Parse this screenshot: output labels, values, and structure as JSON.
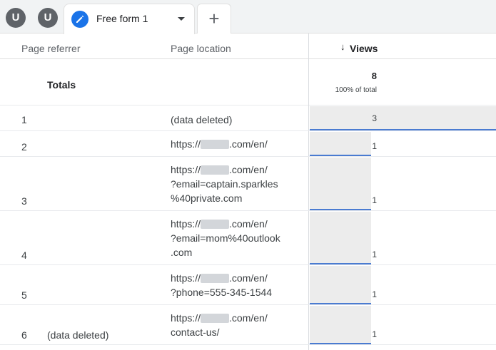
{
  "tabs": {
    "avatars": [
      "U",
      "U"
    ],
    "active_label": "Free form 1",
    "add_label": "+"
  },
  "table": {
    "headers": {
      "referrer": "Page referrer",
      "location": "Page location",
      "views": "Views",
      "sort_arrow": "↓"
    },
    "totals": {
      "label": "Totals",
      "views": "8",
      "percent": "100% of total"
    },
    "rows": [
      {
        "num": "1",
        "referrer": "",
        "location": [
          "(data deleted)"
        ],
        "views": "3",
        "share": 1.0
      },
      {
        "num": "2",
        "referrer": "",
        "location": [
          "https://|.com/en/"
        ],
        "views": "1",
        "share": 0.33
      },
      {
        "num": "3",
        "referrer": "",
        "location": [
          "https://|.com/en/",
          "?email=captain.sparkles",
          "%40private.com"
        ],
        "views": "1",
        "share": 0.33
      },
      {
        "num": "4",
        "referrer": "",
        "location": [
          "https://|.com/en/",
          "?email=mom%40outlook",
          ".com"
        ],
        "views": "1",
        "share": 0.33
      },
      {
        "num": "5",
        "referrer": "",
        "location": [
          "https://|.com/en/",
          "?phone=555-345-1544"
        ],
        "views": "1",
        "share": 0.33
      },
      {
        "num": "6",
        "referrer": "(data deleted)",
        "location": [
          "https://|.com/en/",
          "contact-us/"
        ],
        "views": "1",
        "share": 0.33
      }
    ]
  },
  "colors": {
    "bar_fill": "#ececec",
    "bar_underline": "#4a7bd1",
    "accent": "#1a73e8"
  }
}
